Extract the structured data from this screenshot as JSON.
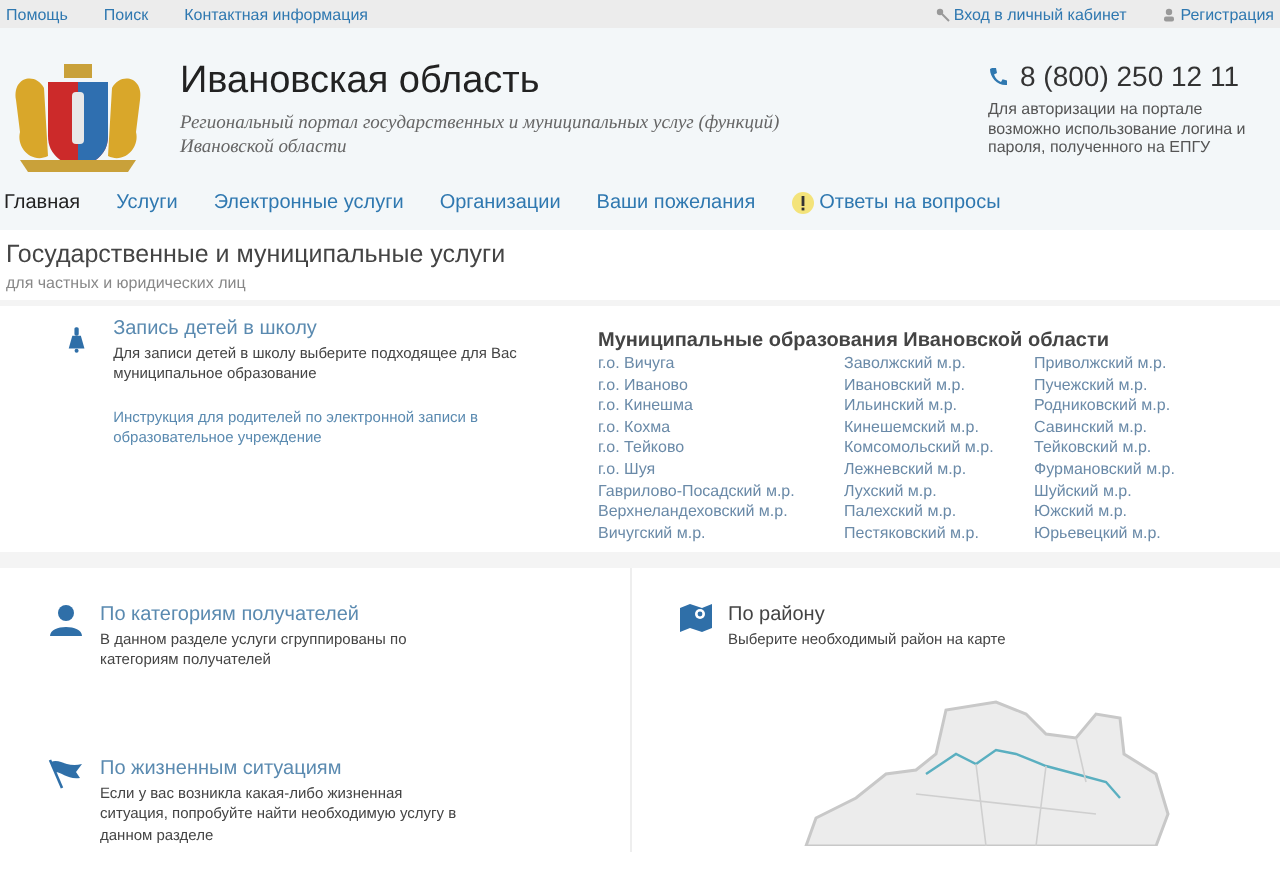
{
  "top_bar": {
    "links": [
      "Помощь",
      "Поиск",
      "Контактная информация"
    ],
    "account_links": [
      {
        "kind": "login",
        "label": "Вход в личный кабинет"
      },
      {
        "kind": "register",
        "label": "Регистрация"
      }
    ]
  },
  "header": {
    "title": "Ивановская область",
    "subtitle": "Региональный портал государственных и муниципальных услуг (функций) Ивановской области",
    "phone": "8 (800) 250 12 11",
    "note": "Для авторизации на портале возможно использование логина и пароля, полученного на ЕПГУ"
  },
  "nav": [
    {
      "label": "Главная",
      "selected": true,
      "kind": "plain"
    },
    {
      "label": "Услуги",
      "selected": false,
      "kind": "plain"
    },
    {
      "label": "Электронные услуги",
      "selected": false,
      "kind": "plain"
    },
    {
      "label": "Организации",
      "selected": false,
      "kind": "plain"
    },
    {
      "label": "Ваши пожелания",
      "selected": false,
      "kind": "plain"
    },
    {
      "label": "Ответы на вопросы",
      "selected": false,
      "kind": "alert"
    }
  ],
  "section": {
    "title": "Государственные и муниципальные услуги",
    "subtitle": "для частных и юридических лиц"
  },
  "school": {
    "title": "Запись детей в школу",
    "text": "Для записи детей в школу выберите подходящее для Вас муниципальное образование",
    "link": "Инструкция для родителей по электронной записи в образовательное учреждение"
  },
  "municipalities": {
    "title": "Муниципальные образования Ивановской области",
    "columns": [
      [
        "г.о. Вичуга",
        "г.о. Иваново",
        "г.о. Кинешма",
        "г.о. Кохма",
        "г.о. Тейково",
        "г.о. Шуя",
        "Гаврилово-Посадский м.р.",
        "Верхнеландеховский м.р.",
        "Вичугский м.р."
      ],
      [
        "Заволжский м.р.",
        "Ивановский м.р.",
        "Ильинский м.р.",
        "Кинешемский м.р.",
        "Комсомольский м.р.",
        "Лежневский м.р.",
        "Лухский м.р.",
        "Палехский м.р.",
        "Пестяковский м.р."
      ],
      [
        "Приволжский м.р.",
        "Пучежский м.р.",
        "Родниковский м.р.",
        "Савинский м.р.",
        "Тейковский м.р.",
        "Фурмановский м.р.",
        "Шуйский м.р.",
        "Южский м.р.",
        "Юрьевецкий м.р."
      ]
    ]
  },
  "categories": [
    {
      "kind": "person",
      "title": "По категориям получателей",
      "text": "В данном разделе услуги сгруппированы по категориям получателей"
    },
    {
      "kind": "flag",
      "title": "По жизненным ситуациям",
      "text": "Если у вас возникла какая-либо жизненная ситуация, попробуйте найти необходимую услугу в данном разделе"
    }
  ],
  "by_district": {
    "title": "По району",
    "text": "Выберите необходимый район на карте"
  }
}
